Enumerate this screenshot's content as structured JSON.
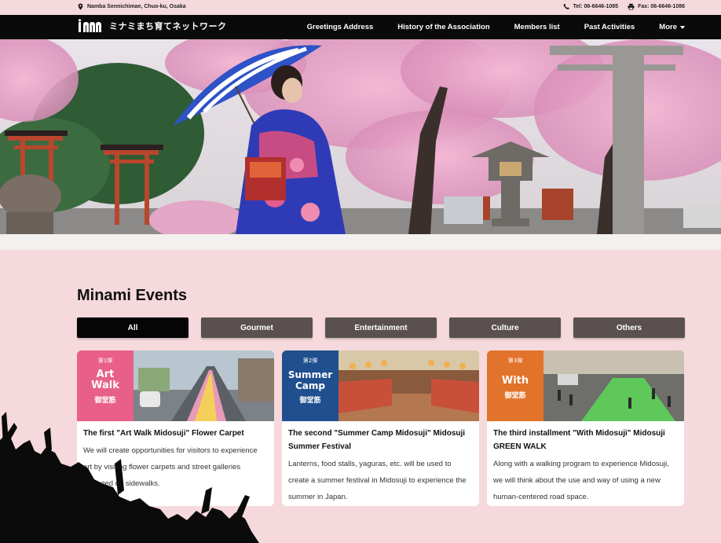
{
  "topbar": {
    "address": "Namba Sennichimae, Chuo-ku, Osaka",
    "tel": "Tel: 06-6646-1085",
    "fax": "Fax: 06-6646-1086"
  },
  "nav": {
    "logo_text": "ミナミまち育てネットワーク",
    "links": [
      "Greetings Address",
      "History of the Association",
      "Members list",
      "Past Activities"
    ],
    "more_label": "More"
  },
  "events": {
    "title": "Minami Events",
    "filters": [
      "All",
      "Gourmet",
      "Entertainment",
      "Culture",
      "Others"
    ],
    "active_filter": "All",
    "cards": [
      {
        "badge_top": "第1弾",
        "badge_main": "Art Walk",
        "badge_sub": "御堂筋",
        "badge_color": "#e8608a",
        "title": "The first \"Art Walk Midosuji\" Flower Carpet",
        "description": "We will create opportunities for visitors to experience art by visiting flower carpets and street galleries arranged on sidewalks."
      },
      {
        "badge_top": "第2弾",
        "badge_main": "Summer Camp",
        "badge_sub": "御堂筋",
        "badge_color": "#1f4f8e",
        "title": "The second \"Summer Camp Midosuji\" Midosuji Summer Festival",
        "description": "Lanterns, food stalls, yaguras, etc. will be used to create a summer festival in Midosuji to experience the summer in Japan."
      },
      {
        "badge_top": "第3弾",
        "badge_main": "With",
        "badge_sub": "御堂筋",
        "badge_color": "#e2732a",
        "title": "The third installment \"With Midosuji\" Midosuji GREEN WALK",
        "description": "Along with a walking program to experience Midosuji, we will think about the use and way of using a new human-centered road space."
      }
    ]
  },
  "colors": {
    "background": "#f6d9dc",
    "nav": "#0a0a0a",
    "filter_inactive": "#5a5050",
    "filter_active": "#050505"
  }
}
